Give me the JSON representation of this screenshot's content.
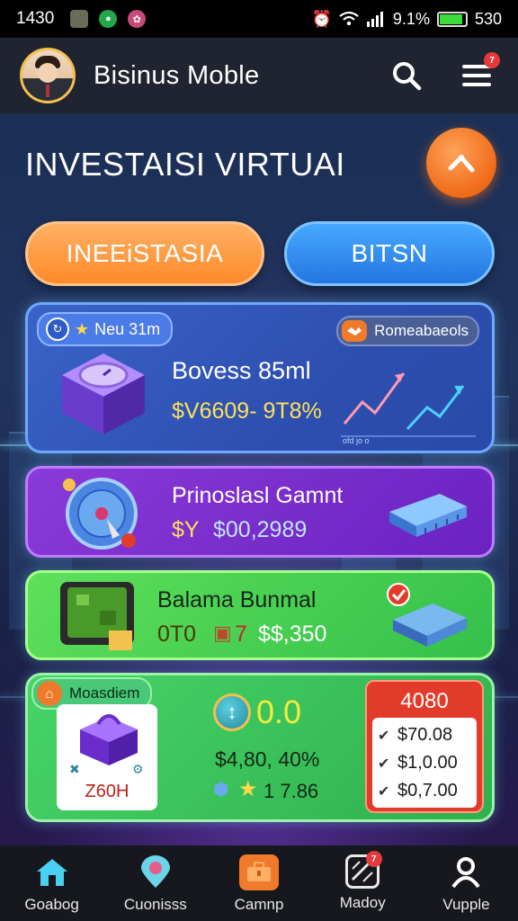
{
  "status_bar": {
    "time": "1430",
    "battery_text": "9.1%",
    "signal_text": "530",
    "battery_level": 0.9
  },
  "header": {
    "title": "Bisinus Moble",
    "menu_badge": "7"
  },
  "main": {
    "page_title": "INVESTAISI VIRTUAI",
    "tabs": [
      {
        "label": "INEEiSTASIA",
        "color": "#ff8a2a"
      },
      {
        "label": "BITSN",
        "color": "#2f8ff0"
      }
    ],
    "cards": [
      {
        "tag": "Neu 31m",
        "badge": "Romeabaeols",
        "title": "Bovess 85ml",
        "amount": "$V6609- 9T8%",
        "chart_ticks": "ofd  jo  o"
      },
      {
        "title": "Prinoslasl Gamnt",
        "amount_prefix": "$Y",
        "amount": "$00,2989"
      },
      {
        "title": "Balama Bunmal",
        "amount_prefix": "0T0",
        "amount_mid": "7",
        "amount": "$$,350"
      },
      {
        "tag": "Moasdiem",
        "product_label": "Z60H",
        "score": "0.0",
        "amount": "$4,80, 40%",
        "rating": "1  7.86",
        "panel": {
          "header": "4080",
          "rows": [
            "$70.08",
            "$1,0.00",
            "$0,7.00"
          ]
        }
      }
    ]
  },
  "nav": {
    "items": [
      {
        "label": "Goabog",
        "icon": "home-icon"
      },
      {
        "label": "Cuonisss",
        "icon": "location-icon"
      },
      {
        "label": "Camnp",
        "icon": "briefcase-icon"
      },
      {
        "label": "Madoy",
        "icon": "chart-icon",
        "badge": "7"
      },
      {
        "label": "Vupple",
        "icon": "user-icon"
      }
    ]
  }
}
